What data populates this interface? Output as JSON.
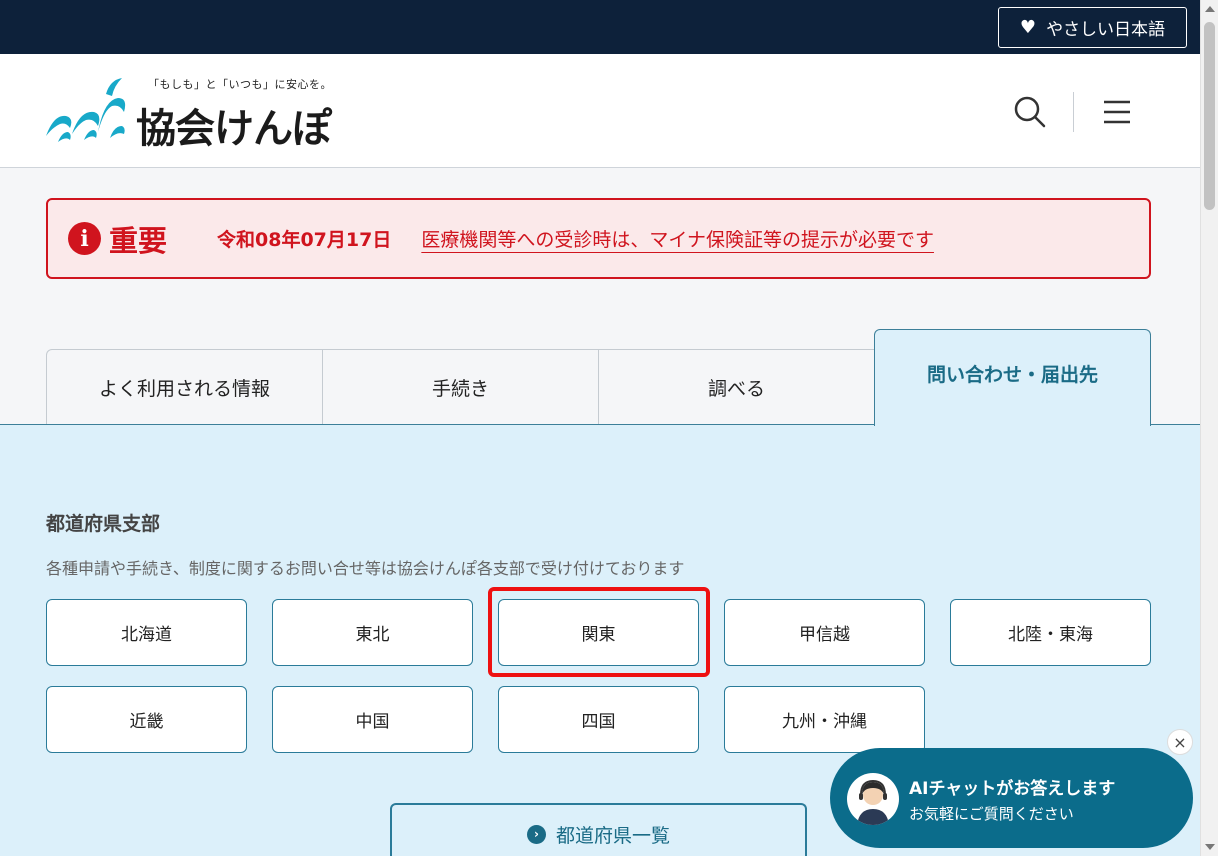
{
  "topbar": {
    "easy_japanese_label": "やさしい日本語",
    "icon": "heart-icon"
  },
  "header": {
    "tagline": "「もしも」と「いつも」に安心を。",
    "logo_text": "協会けんぽ",
    "search_icon": "search-icon",
    "menu_icon": "hamburger-menu-icon"
  },
  "notice": {
    "icon_glyph": "i",
    "label": "重要",
    "date": "令和08年07月17日",
    "link_text": "医療機関等への受診時は、マイナ保険証等の提示が必要です"
  },
  "tabs": [
    {
      "label": "よく利用される情報",
      "active": false
    },
    {
      "label": "手続き",
      "active": false
    },
    {
      "label": "調べる",
      "active": false
    },
    {
      "label": "問い合わせ・届出先",
      "active": true
    }
  ],
  "branches": {
    "heading": "都道府県支部",
    "description": "各種申請や手続き、制度に関するお問い合せ等は協会けんぽ各支部で受け付けております",
    "regions": [
      "北海道",
      "東北",
      "関東",
      "甲信越",
      "北陸・東海",
      "近畿",
      "中国",
      "四国",
      "九州・沖縄"
    ],
    "highlighted_region": "関東",
    "list_button_label": "都道府県一覧",
    "list_button_icon_glyph": "›"
  },
  "chat": {
    "title": "AIチャットがお答えします",
    "subtitle": "お気軽にご質問ください",
    "close_glyph": "×"
  },
  "colors": {
    "topbar": "#0d213a",
    "important_red": "#d0141e",
    "panel_bg": "#dcf0fa",
    "accent_teal": "#1a6b86",
    "chat_bg": "#0b6c8b"
  }
}
